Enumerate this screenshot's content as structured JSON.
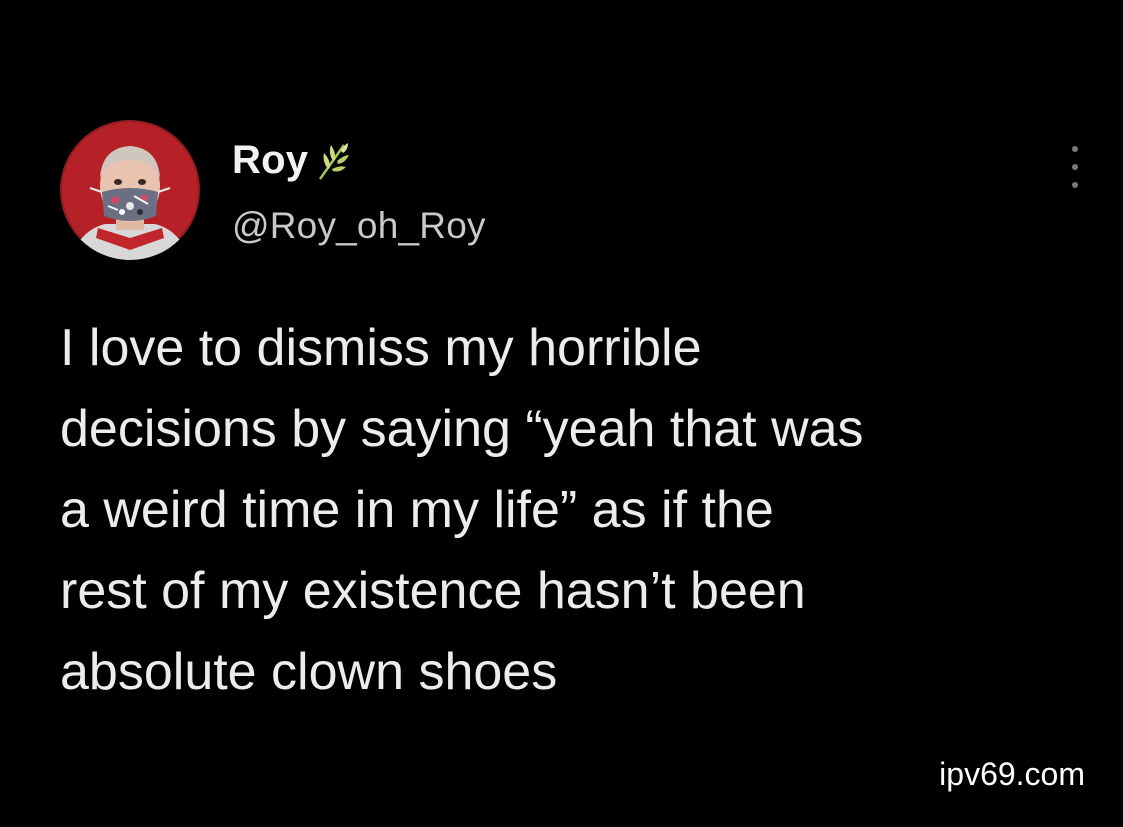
{
  "tweet": {
    "display_name": "Roy",
    "name_emoji": "wheat-emoji-icon",
    "handle": "@Roy_oh_Roy",
    "text_lines": [
      "I love to dismiss my horrible",
      "decisions by saying “yeah that was",
      "a weird time in my life” as if the",
      "rest of my existence hasn’t been",
      "absolute clown shoes"
    ]
  },
  "watermark": "ipv69.com",
  "colors": {
    "background": "#000000",
    "text": "#ECECEC",
    "handle": "#C9C9C9",
    "avatar_ring": "#B31F24"
  }
}
